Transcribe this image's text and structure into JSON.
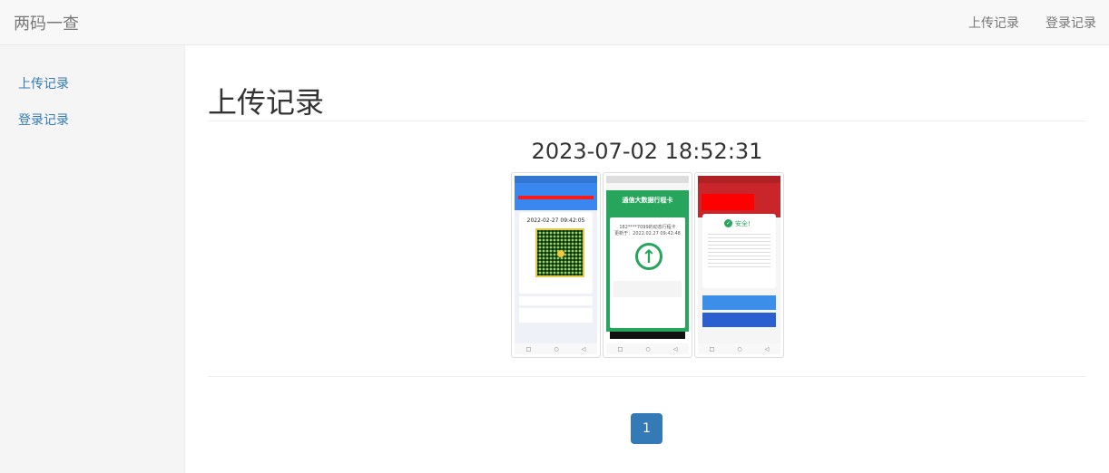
{
  "brand": "两码一查",
  "nav": {
    "upload": "上传记录",
    "login": "登录记录"
  },
  "sidebar": {
    "items": [
      {
        "label": "上传记录"
      },
      {
        "label": "登录记录"
      }
    ]
  },
  "main": {
    "title": "上传记录",
    "records": [
      {
        "time": "2023-07-02 18:52:31"
      }
    ]
  },
  "screens": {
    "health": {
      "time": "2022-02-27 09:42:05"
    },
    "travel": {
      "title": "通信大数据行程卡",
      "phone": "182****7099的动态行程卡",
      "update": "更新于：2022.02.27 09:42:48"
    },
    "safety": {
      "status": "安全!"
    }
  },
  "pagination": {
    "current": "1"
  },
  "colors": {
    "primary": "#337ab7",
    "health_blue": "#3a87f0",
    "travel_green": "#27a55d",
    "alert_red": "#c8262b"
  }
}
